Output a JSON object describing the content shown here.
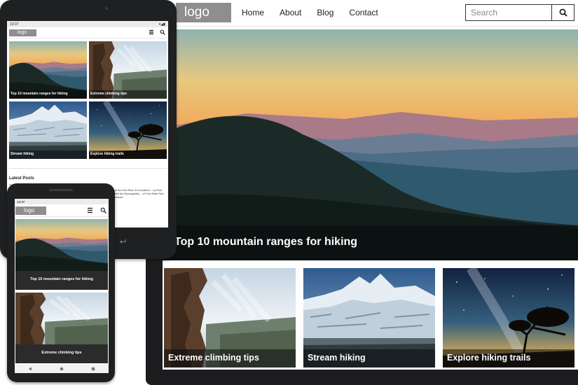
{
  "desktop": {
    "logo": "logo",
    "nav": [
      "Home",
      "About",
      "Blog",
      "Contact"
    ],
    "search": {
      "placeholder": "Search",
      "button_icon": "search-icon"
    },
    "hero_caption": "Top 10 mountain ranges for hiking",
    "cards": [
      "Extreme climbing tips",
      "Stream hiking",
      "Explore hiking trails"
    ]
  },
  "tablet": {
    "status_time": "13:37",
    "logo": "logo",
    "tiles": [
      "Top 10 mountain ranges for hiking",
      "Extreme climbing tips",
      "Stream hiking",
      "Explore hiking trails"
    ],
    "latest_heading": "Latest Posts",
    "post_excerpt": "...ary of the Ohio River, it is located in ...ny River joins with the Monongahela ... of Point State Park in Downtown"
  },
  "phone": {
    "status_time": "13:37",
    "logo": "logo",
    "tiles": [
      "Top 10 mountain ranges for hiking",
      "Extreme climbing tips"
    ]
  },
  "colors": {
    "device_frame": "#1f2021",
    "logo_bg": "#8e8e8e",
    "caption_overlay": "rgba(10,10,12,0.55)"
  }
}
